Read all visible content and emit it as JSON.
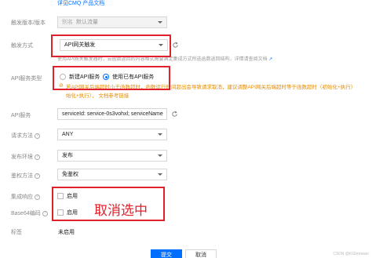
{
  "top_link": "详见CMQ 产品文档",
  "fields": {
    "trigger_version": {
      "label": "触发版本/版本",
      "prefix": "别名",
      "value": "默认流量"
    },
    "trigger_method": {
      "label": "触发方式",
      "value": "API网关触发",
      "hint": "使用API网关触发器时，云函数返回的内容格式需要满足集成方式所选函数返回结构，详情请查阅文档",
      "hint_link": "查阅文档"
    },
    "api_service_type": {
      "label": "API服务类型",
      "options": [
        "新建API服务",
        "使用已有API服务"
      ],
      "selected": "使用已有API服务",
      "warn_line1": "若API网关后端超时小于函数超时，函数运行时间超出会导致请求取消，建议调整API网关后端超时等于函数超时（初始化+执行）",
      "warn_line2": "始化+执行）， 文档参考链接"
    },
    "api_service": {
      "label": "API服务",
      "value": "serviceId: service-0s3vohxl; serviceName"
    },
    "request_method": {
      "label": "请求方法",
      "value": "ANY"
    },
    "publish_env": {
      "label": "发布环境",
      "value": "发布"
    },
    "auth_method": {
      "label": "鉴权方法",
      "value": "免鉴权"
    },
    "integration_response": {
      "label": "集成响应",
      "checkbox": "启用"
    },
    "base64_encoding": {
      "label": "Base64编码",
      "checkbox": "启用"
    },
    "tag": {
      "label": "标签",
      "value": "未启用"
    }
  },
  "annotation": "取消选中",
  "buttons": {
    "submit": "提交",
    "cancel": "取消"
  },
  "watermark": "CSDN @KGbrowser",
  "colors": {
    "primary": "#006eff",
    "annotation_red": "#e0202a",
    "warning": "#e58b00"
  }
}
